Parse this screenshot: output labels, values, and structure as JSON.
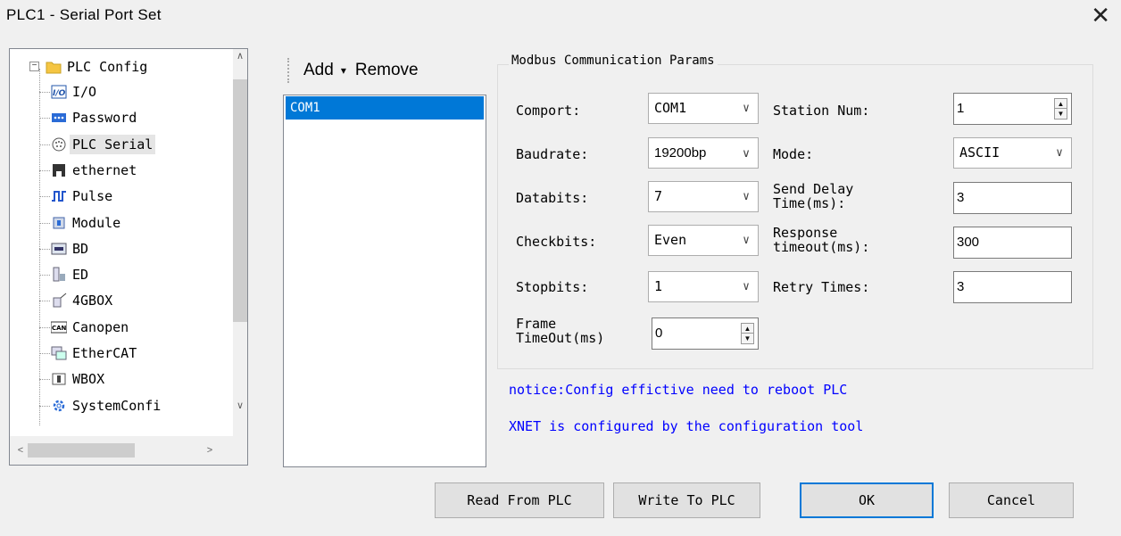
{
  "window": {
    "title": "PLC1 - Serial Port  Set",
    "close_glyph": "✕"
  },
  "tree": {
    "root": {
      "label": "PLC Config",
      "expander": "−"
    },
    "items": [
      {
        "label": "I/O",
        "icon": "io-icon"
      },
      {
        "label": "Password",
        "icon": "password-icon"
      },
      {
        "label": "PLC Serial",
        "icon": "serial-port-icon"
      },
      {
        "label": "ethernet",
        "icon": "ethernet-icon"
      },
      {
        "label": "Pulse",
        "icon": "pulse-icon"
      },
      {
        "label": "Module",
        "icon": "module-icon"
      },
      {
        "label": "BD",
        "icon": "bd-icon"
      },
      {
        "label": "ED",
        "icon": "ed-icon"
      },
      {
        "label": "4GBOX",
        "icon": "4gbox-icon"
      },
      {
        "label": "Canopen",
        "icon": "canopen-icon"
      },
      {
        "label": "EtherCAT",
        "icon": "ethercat-icon"
      },
      {
        "label": "WBOX",
        "icon": "wbox-icon"
      },
      {
        "label": "SystemConfi",
        "icon": "gear-icon"
      }
    ],
    "selected": "PLC Serial",
    "scroll_up": "∧",
    "scroll_down": "∨",
    "scroll_left": "<",
    "scroll_right": ">"
  },
  "toolbar": {
    "add_label": "Add",
    "add_caret": "▾",
    "remove_label": "Remove"
  },
  "port_list": {
    "items": [
      "COM1"
    ],
    "selected": "COM1"
  },
  "params": {
    "group_title": "Modbus Communication Params",
    "comport": {
      "label": "Comport:",
      "value": "COM1"
    },
    "baudrate": {
      "label": "Baudrate:",
      "value": "19200bp"
    },
    "databits": {
      "label": "Databits:",
      "value": "7"
    },
    "checkbits": {
      "label": "Checkbits:",
      "value": "Even"
    },
    "stopbits": {
      "label": "Stopbits:",
      "value": "1"
    },
    "frame_timeout": {
      "label_line1": "Frame",
      "label_line2": "TimeOut(ms)",
      "value": "0"
    },
    "station_num": {
      "label": "Station Num:",
      "value": "1"
    },
    "mode": {
      "label": "Mode:",
      "value": "ASCII"
    },
    "send_delay": {
      "label_line1": "Send Delay",
      "label_line2": "Time(ms):",
      "value": "3"
    },
    "response_timeout": {
      "label_line1": "Response",
      "label_line2": "timeout(ms):",
      "value": "300"
    },
    "retry_times": {
      "label": "Retry Times:",
      "value": "3"
    },
    "dropdown_glyph": "∨",
    "spin_up": "▲",
    "spin_down": "▼"
  },
  "notices": {
    "reboot": "notice:Config effictive need to reboot PLC",
    "xnet": "XNET is configured by the configuration tool"
  },
  "buttons": {
    "read": "Read From PLC",
    "write": "Write To PLC",
    "ok": "OK",
    "cancel": "Cancel"
  },
  "colors": {
    "selection": "#0078d7",
    "notice": "#0000ff",
    "background": "#f0f0f0"
  }
}
